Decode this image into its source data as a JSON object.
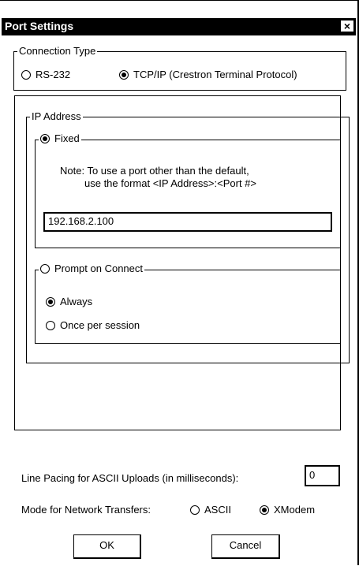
{
  "title": "Port Settings",
  "close_glyph": "×",
  "connection_type": {
    "legend": "Connection Type",
    "options": [
      {
        "label": "RS-232",
        "selected": false
      },
      {
        "label": "TCP/IP (Crestron Terminal Protocol)",
        "selected": true
      }
    ]
  },
  "ip_address": {
    "legend": "IP Address",
    "fixed_label": "Fixed",
    "fixed_selected": true,
    "note_line1": "Note: To use a port other than the default,",
    "note_line2": "use the format <IP Address>:<Port #>",
    "ip_value": "192.168.2.100",
    "prompt_label": "Prompt on Connect",
    "prompt_selected": false,
    "prompt_options": [
      {
        "label": "Always",
        "selected": true
      },
      {
        "label": "Once per session",
        "selected": false
      }
    ]
  },
  "line_pacing": {
    "label": "Line Pacing for ASCII Uploads (in milliseconds):",
    "value": "0"
  },
  "mode_transfers": {
    "label": "Mode for Network Transfers:",
    "options": [
      {
        "label": "ASCII",
        "selected": false
      },
      {
        "label": "XModem",
        "selected": true
      }
    ]
  },
  "buttons": {
    "ok": "OK",
    "cancel": "Cancel"
  }
}
